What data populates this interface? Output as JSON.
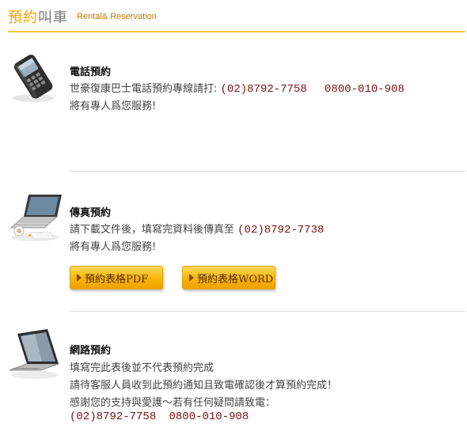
{
  "header": {
    "title_highlight": "預約",
    "title_rest": "叫車",
    "subtitle": "Rental& Reservation"
  },
  "phone_section": {
    "icon": "phone-icon",
    "title": "電話預約",
    "line1_prefix": "世豪復康巴士電話預約專線請打:",
    "phone1": "(02)8792-7758",
    "phone2": "0800-010-908",
    "line2": "將有專人爲您服務!"
  },
  "fax_section": {
    "icon": "laptop-fax-icon",
    "title": "傳真預約",
    "line1_prefix": "請下載文件後，填寫完資料後傳真至",
    "fax": "(02)8792-7738",
    "line2": "將有專人爲您服務!",
    "buttons": [
      {
        "label": "預約表格PDF"
      },
      {
        "label": "預約表格WORD"
      }
    ]
  },
  "web_section": {
    "icon": "laptop-web-icon",
    "title": "網路預約",
    "lines": [
      "填寫完此表後並不代表預約完成",
      "請待客服人員收到此預約通知且致電確認後才算預約完成！",
      "感謝您的支持與愛護～若有任何疑問請致電："
    ],
    "phone1": "(02)8792-7758",
    "phone2": "0800-010-908"
  },
  "colors": {
    "accent": "#f0a200",
    "phone_text": "#7a1010",
    "button_top": "#ffd95a",
    "button_bottom": "#f0a000"
  }
}
